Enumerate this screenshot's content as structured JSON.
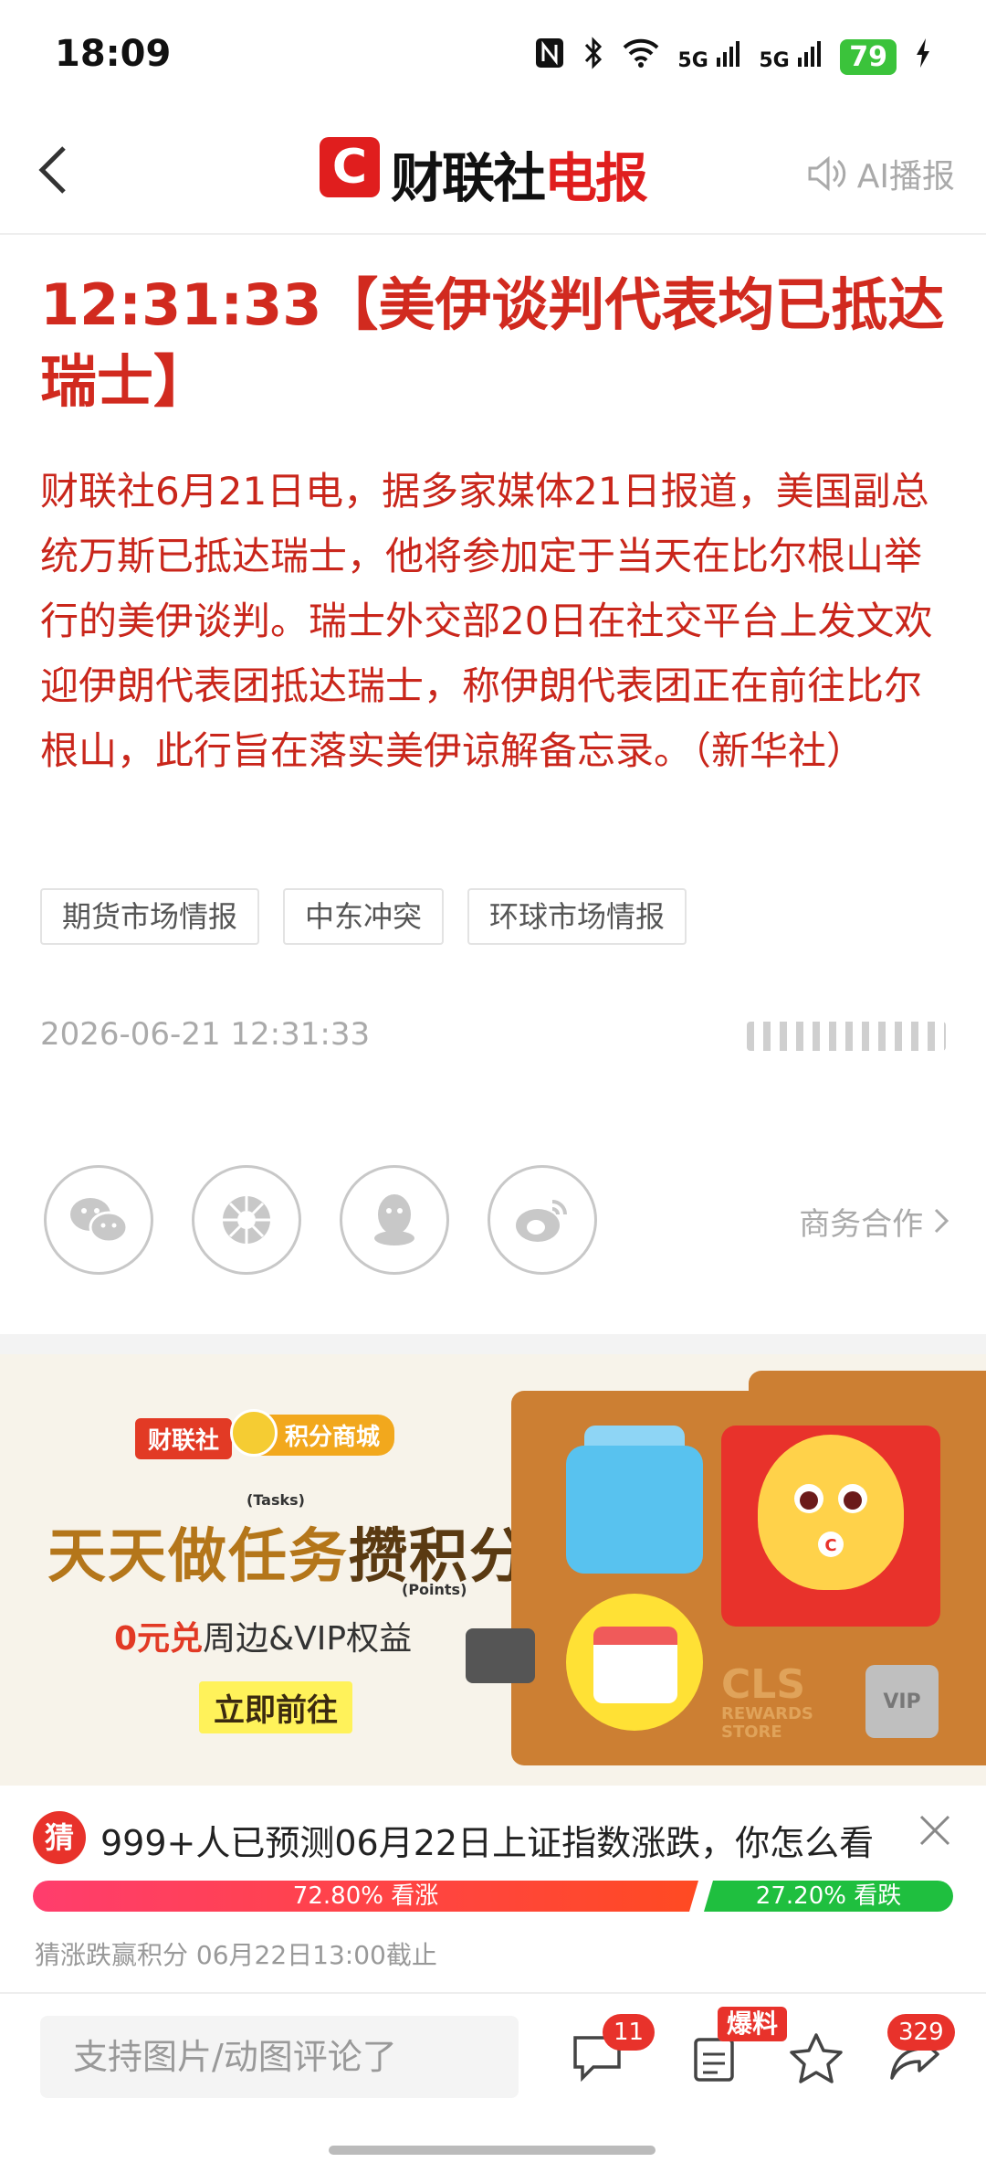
{
  "status": {
    "time": "18:09",
    "battery": "79",
    "sig1": "5G",
    "sig2": "5G"
  },
  "header": {
    "logo_c": "C",
    "logo_black": "财联社",
    "logo_red": "电报",
    "ai_label": "AI播报"
  },
  "article": {
    "title": "12:31:33【美伊谈判代表均已抵达瑞士】",
    "body": "财联社6月21日电，据多家媒体21日报道，美国副总统万斯已抵达瑞士，他将参加定于当天在比尔根山举行的美伊谈判。瑞士外交部20日在社交平台上发文欢迎伊朗代表团抵达瑞士，称伊朗代表团正在前往比尔根山，此行旨在落实美伊谅解备忘录。（新华社）",
    "tags": [
      "期货市场情报",
      "中东冲突",
      "环球市场情报"
    ],
    "datetime": "2026-06-21 12:31:33"
  },
  "share": {
    "biz_label": "商务合作"
  },
  "banner": {
    "brand": "财联社",
    "mall": "积分商城",
    "tasks_en": "(Tasks)",
    "headline_a": "天天做任务",
    "headline_b": "攒积分",
    "points_en": "(Points)",
    "sub_red": "0元兑",
    "sub_rest": "周边&VIP权益",
    "cta": "立即前往",
    "cls": "CLS",
    "rewards": "REWARDS",
    "store": "STORE",
    "vip": "VIP",
    "cat_mark": "C"
  },
  "prediction": {
    "icon": "猜",
    "question": "999+人已预测06月22日上证指数涨跌，你怎么看",
    "up_label": "72.80% 看涨",
    "down_label": "27.20% 看跌",
    "up_pct": 72.8,
    "down_pct": 27.2,
    "note": "猜涨跌赢积分  06月22日13:00截止"
  },
  "bottom": {
    "comment_placeholder": "支持图片/动图评论了",
    "comment_count": "11",
    "baoliao": "爆料",
    "share_count": "329"
  },
  "colors": {
    "brand_red": "#e01e1e",
    "up_red": "#ff3d3d",
    "down_green": "#1fbf3f"
  }
}
